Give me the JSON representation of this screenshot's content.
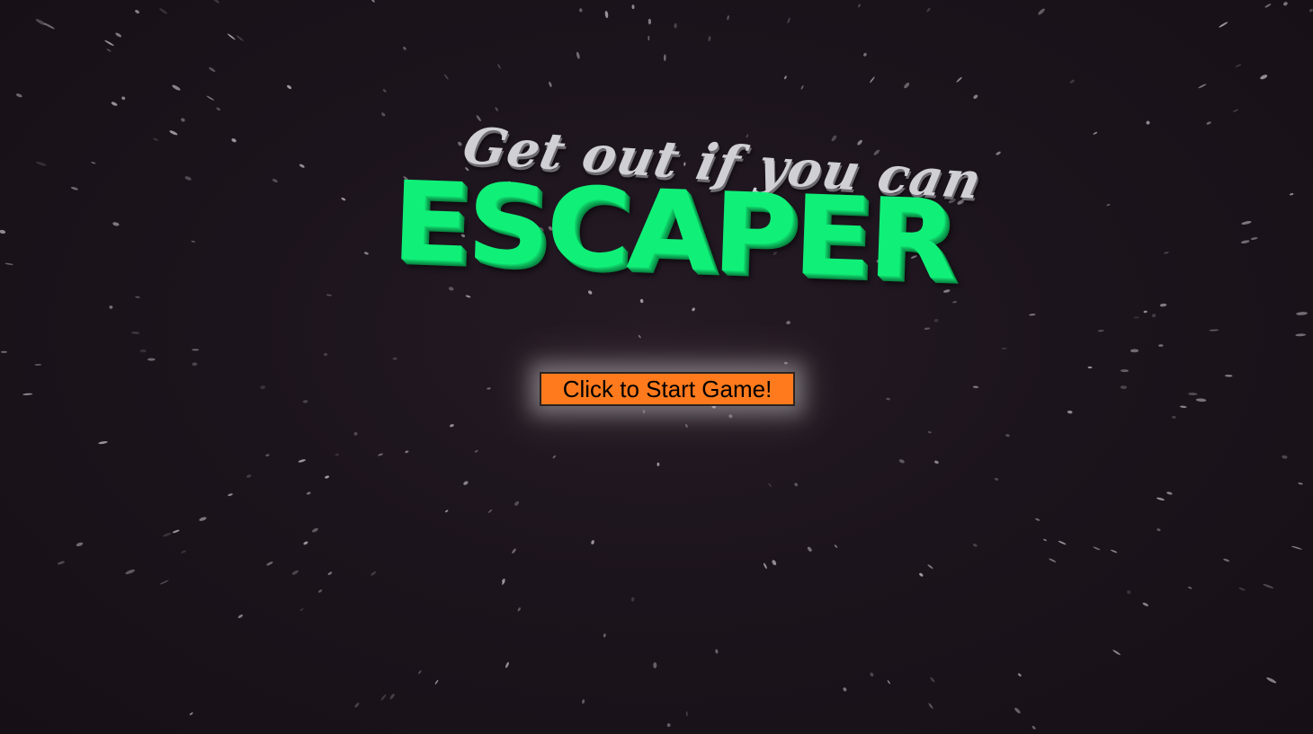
{
  "game": {
    "tagline": "Get out if you can",
    "title": "ESCAPER",
    "start_button_label": "Click to Start Game!"
  },
  "colors": {
    "background": "#1c141c",
    "title_green": "#10f078",
    "tagline_gray": "#cfcfd4",
    "button_orange": "#ff7a1c",
    "star": "#d8d2dc"
  }
}
